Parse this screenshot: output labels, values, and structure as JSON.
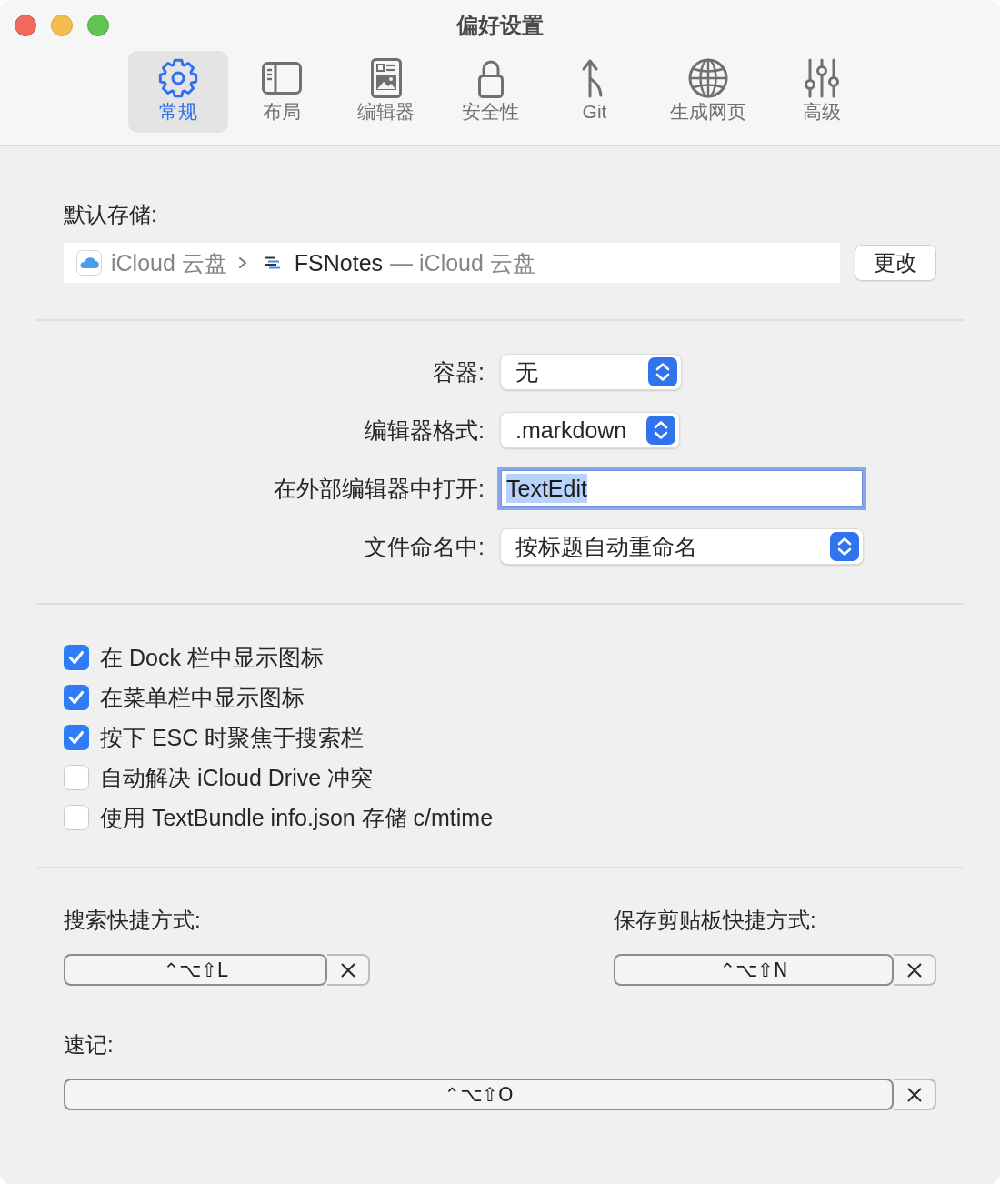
{
  "window": {
    "title": "偏好设置"
  },
  "tabs": [
    {
      "label": "常规",
      "selected": true
    },
    {
      "label": "布局",
      "selected": false
    },
    {
      "label": "编辑器",
      "selected": false
    },
    {
      "label": "安全性",
      "selected": false
    },
    {
      "label": "Git",
      "selected": false
    },
    {
      "label": "生成网页",
      "selected": false
    },
    {
      "label": "高级",
      "selected": false
    }
  ],
  "storage": {
    "label": "默认存储:",
    "volume": "iCloud 云盘",
    "folder": "FSNotes",
    "location": "— iCloud 云盘",
    "button": "更改"
  },
  "options": [
    {
      "kind": "popup",
      "label": "容器:",
      "value": "无"
    },
    {
      "kind": "popup",
      "label": "编辑器格式:",
      "value": ".markdown"
    },
    {
      "kind": "field",
      "label": "在外部编辑器中打开:",
      "value": "TextEdit",
      "focused": true
    },
    {
      "kind": "popup",
      "label": "文件命名中:",
      "value": "按标题自动重命名"
    }
  ],
  "checkboxes": [
    {
      "label": "在 Dock 栏中显示图标",
      "checked": true
    },
    {
      "label": "在菜单栏中显示图标",
      "checked": true
    },
    {
      "label": "按下 ESC 时聚焦于搜索栏",
      "checked": true
    },
    {
      "label": "自动解决 iCloud Drive 冲突",
      "checked": false
    },
    {
      "label": "使用 TextBundle info.json 存储 c/mtime",
      "checked": false
    }
  ],
  "shortcuts": [
    {
      "label": "搜索快捷方式:",
      "value": "⌃⌥⇧L"
    },
    {
      "label": "保存剪贴板快捷方式:",
      "value": "⌃⌥⇧N"
    },
    {
      "label": "速记:",
      "value": "⌃⌥⇧O"
    }
  ]
}
